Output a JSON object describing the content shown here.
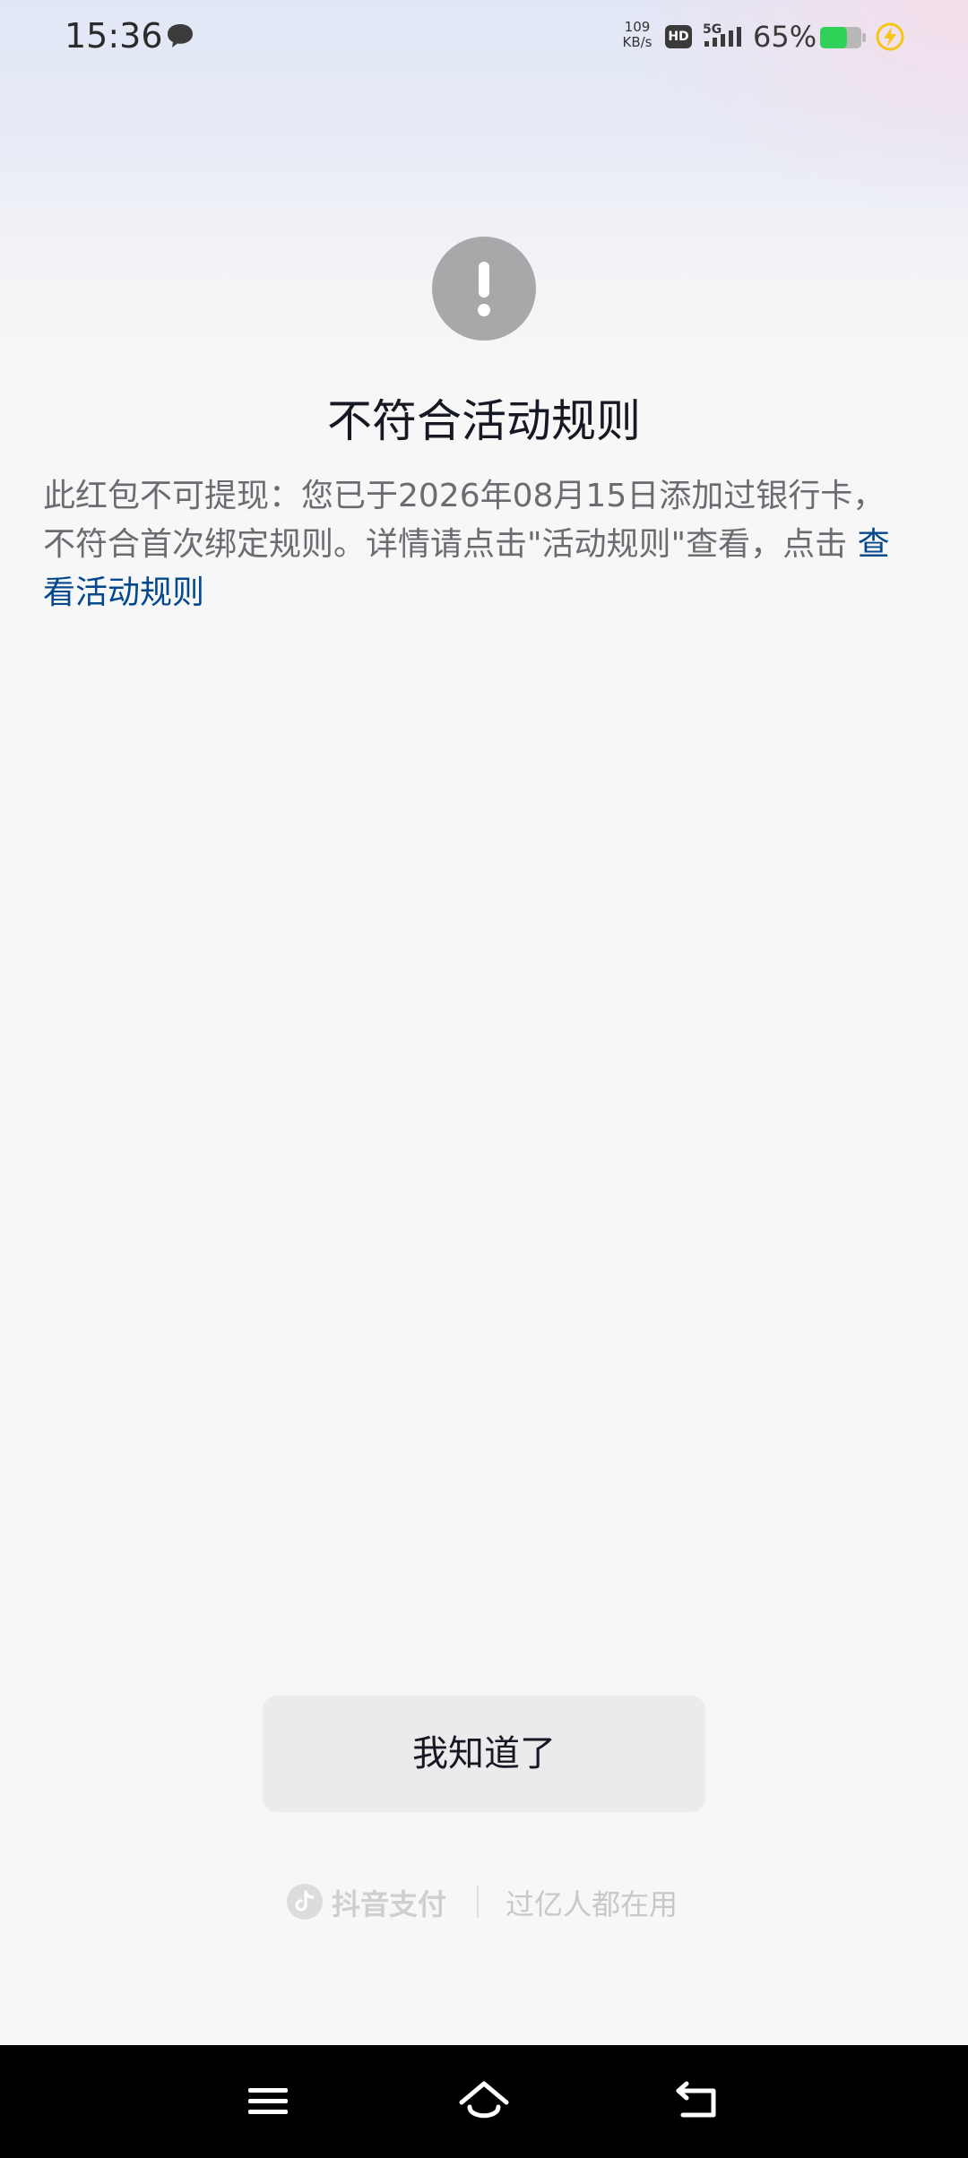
{
  "status_bar": {
    "time": "15:36",
    "net_speed_value": "109",
    "net_speed_unit": "KB/s",
    "hd_label": "HD",
    "network_type": "5G",
    "battery_percent": "65%",
    "battery_level": 0.65,
    "icons": [
      "message-icon",
      "hd-icon",
      "signal-icon",
      "battery-icon",
      "charging-icon"
    ]
  },
  "dialog": {
    "icon": "exclamation-icon",
    "title": "不符合活动规则",
    "message_prefix": "此红包不可提现：您已于2026年08月15日添加过银行卡，不符合首次绑定规则。详情请点击\"活动规则\"查看，点击",
    "rule_link_label": "查看活动规则",
    "confirm_label": "我知道了"
  },
  "footer": {
    "brand_name": "抖音支付",
    "slogan": "过亿人都在用",
    "logo_icon": "douyin-logo-icon"
  },
  "nav": {
    "icons": [
      "menu-icon",
      "home-icon",
      "back-icon"
    ]
  },
  "colors": {
    "link": "#04498d",
    "battery": "#2fd158",
    "charge": "#f5c518",
    "alert_circle": "#a8a8ab"
  }
}
